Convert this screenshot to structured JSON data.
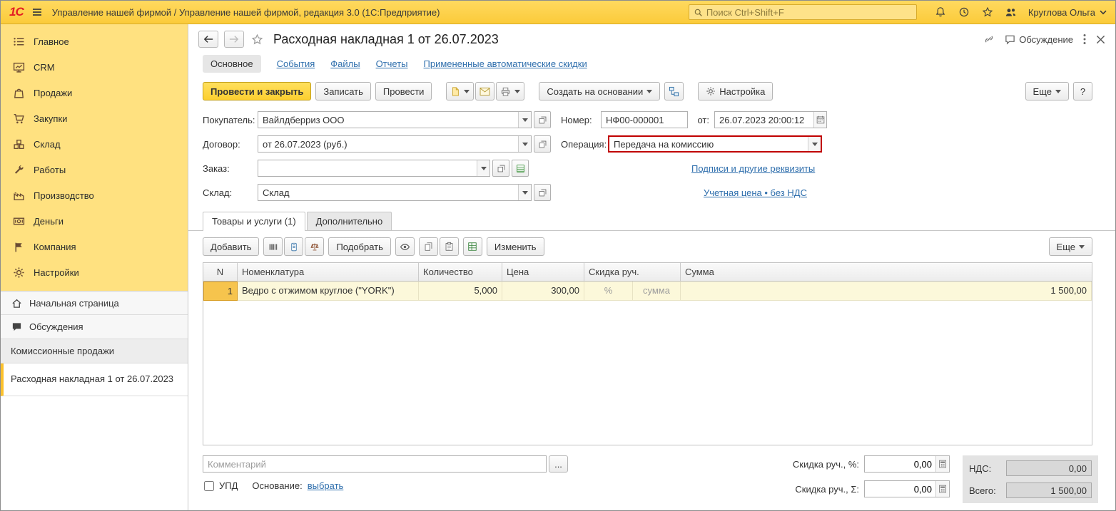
{
  "colors": {
    "brand_yellow": "#fccf2f",
    "sidebar_yellow": "#ffe180",
    "accent_red": "#c00000",
    "link_blue": "#2f6fad",
    "row_highlight": "#fcf8da"
  },
  "topbar": {
    "logo": "1С",
    "title": "Управление нашей фирмой / Управление нашей фирмой, редакция 3.0  (1С:Предприятие)",
    "search_placeholder": "Поиск Ctrl+Shift+F",
    "user_name": "Круглова Ольга"
  },
  "sidebar": {
    "items": [
      {
        "label": "Главное",
        "icon": "list-icon"
      },
      {
        "label": "CRM",
        "icon": "monitor-icon"
      },
      {
        "label": "Продажи",
        "icon": "bag-icon"
      },
      {
        "label": "Закупки",
        "icon": "cart-icon"
      },
      {
        "label": "Склад",
        "icon": "boxes-icon"
      },
      {
        "label": "Работы",
        "icon": "tools-icon"
      },
      {
        "label": "Производство",
        "icon": "production-icon"
      },
      {
        "label": "Деньги",
        "icon": "money-icon"
      },
      {
        "label": "Компания",
        "icon": "flag-icon"
      },
      {
        "label": "Настройки",
        "icon": "gear-icon"
      }
    ],
    "footer_items": [
      {
        "label": "Начальная страница",
        "icon": "home-icon"
      },
      {
        "label": "Обсуждения",
        "icon": "chat-icon"
      },
      {
        "label": "Комиссионные продажи"
      },
      {
        "label": "Расходная накладная 1 от 26.07.2023",
        "active": true
      }
    ]
  },
  "doc": {
    "title": "Расходная накладная 1 от 26.07.2023",
    "discussion": "Обсуждение",
    "nav_tabs": [
      {
        "label": "Основное"
      },
      {
        "label": "События"
      },
      {
        "label": "Файлы"
      },
      {
        "label": "Отчеты"
      },
      {
        "label": "Примененные автоматические скидки"
      }
    ],
    "toolbar": {
      "post_and_close": "Провести и закрыть",
      "write": "Записать",
      "post": "Провести",
      "create_on_basis": "Создать на основании",
      "settings": "Настройка",
      "more": "Еще",
      "help": "?"
    },
    "fields": {
      "buyer": {
        "label": "Покупатель:",
        "value": "Вайлдберриз ООО"
      },
      "number": {
        "label": "Номер:",
        "value": "НФ00-000001"
      },
      "date": {
        "label": "от:",
        "value": "26.07.2023 20:00:12"
      },
      "contract": {
        "label": "Договор:",
        "value": "от 26.07.2023 (руб.)"
      },
      "operation": {
        "label": "Операция:",
        "value": "Передача на комиссию"
      },
      "order": {
        "label": "Заказ:",
        "value": ""
      },
      "warehouse": {
        "label": "Склад:",
        "value": "Склад"
      },
      "link_signatures": "Подписи и другие реквизиты",
      "link_price": "Учетная цена • без НДС"
    },
    "sheet_tabs": [
      {
        "label": "Товары и услуги (1)"
      },
      {
        "label": "Дополнительно"
      }
    ],
    "grid_toolbar": {
      "add": "Добавить",
      "pick": "Подобрать",
      "change": "Изменить",
      "more": "Еще"
    },
    "grid": {
      "columns": {
        "n": "N",
        "nomenclature": "Номенклатура",
        "quantity": "Количество",
        "price": "Цена",
        "discount": "Скидка руч.",
        "sum": "Сумма"
      },
      "rows": [
        {
          "n": "1",
          "nomenclature": "Ведро с отжимом  круглое (\"YORK\")",
          "quantity": "5,000",
          "price": "300,00",
          "discount_percent": "%",
          "discount_sum": "сумма",
          "sum": "1 500,00"
        }
      ]
    },
    "footer": {
      "comment_placeholder": "Комментарий",
      "more_button": "...",
      "upd": "УПД",
      "basis_label": "Основание:",
      "basis_link": "выбрать",
      "discount_percent_label": "Скидка руч., %:",
      "discount_percent_value": "0,00",
      "discount_sum_label": "Скидка руч., Σ:",
      "discount_sum_value": "0,00",
      "vat_label": "НДС:",
      "vat_value": "0,00",
      "total_label": "Всего:",
      "total_value": "1 500,00"
    }
  }
}
